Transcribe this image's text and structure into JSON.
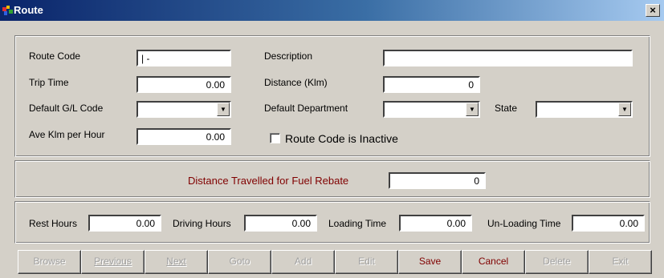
{
  "window": {
    "title": "Route",
    "close_glyph": "×",
    "icon": "route-app-icon"
  },
  "route": {
    "route_code_label": "Route Code",
    "route_code_value": "|  -",
    "description_label": "Description",
    "description_value": "",
    "trip_time_label": "Trip Time",
    "trip_time_value": "0.00",
    "distance_label": "Distance (Klm)",
    "distance_value": "0",
    "gl_code_label": "Default G/L Code",
    "gl_code_value": "",
    "department_label": "Default Department",
    "department_value": "",
    "state_label": "State",
    "state_value": "",
    "ave_klm_label": "Ave Klm per Hour",
    "ave_klm_value": "0.00",
    "inactive_label": "Route Code is Inactive",
    "inactive_checked": false
  },
  "fuel": {
    "label": "Distance Travelled for Fuel Rebate",
    "value": "0",
    "label_color": "#800000"
  },
  "hours": {
    "rest_label": "Rest Hours",
    "rest_value": "0.00",
    "driving_label": "Driving Hours",
    "driving_value": "0.00",
    "loading_label": "Loading Time",
    "loading_value": "0.00",
    "unloading_label": "Un-Loading Time",
    "unloading_value": "0.00"
  },
  "toolbar": {
    "browse": "Browse",
    "previous": "Previous",
    "next": "Next",
    "goto": "Goto",
    "add": "Add",
    "edit": "Edit",
    "save": "Save",
    "cancel": "Cancel",
    "delete": "Delete",
    "exit": "Exit"
  },
  "colors": {
    "titlebar_start": "#0a246a",
    "titlebar_end": "#a6caf0",
    "face": "#d4d0c8",
    "accent": "#800000"
  }
}
